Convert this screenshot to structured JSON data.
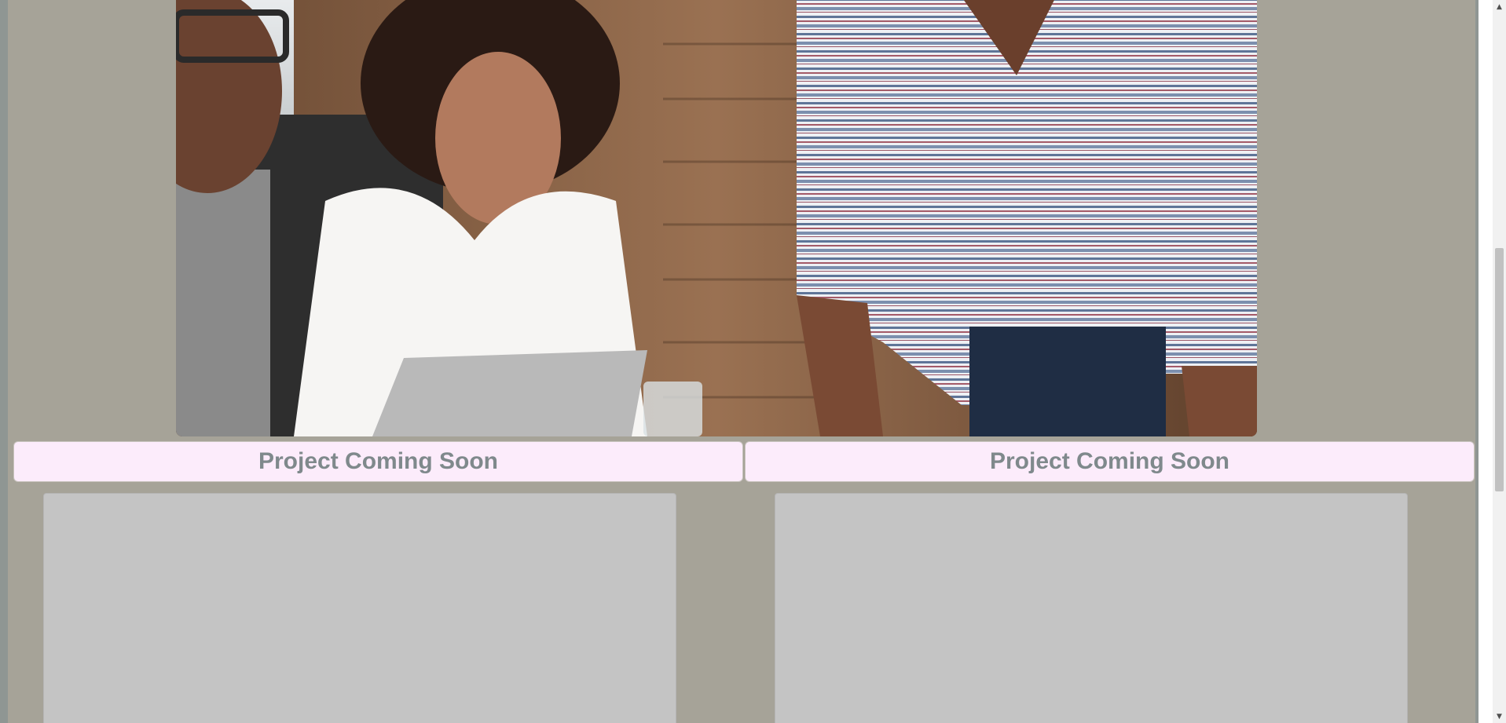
{
  "hero": {
    "image_alt": "Team of three colleagues looking at a laptop"
  },
  "projects": [
    {
      "title": "Project Coming Soon"
    },
    {
      "title": "Project Coming Soon"
    }
  ],
  "colors": {
    "page_background": "#a6a398",
    "title_background": "#fcecfb",
    "title_text": "#7f898c",
    "card_placeholder": "#c4c4c4"
  },
  "scrollbar": {
    "up_icon": "triangle-up",
    "down_icon": "triangle-down"
  }
}
